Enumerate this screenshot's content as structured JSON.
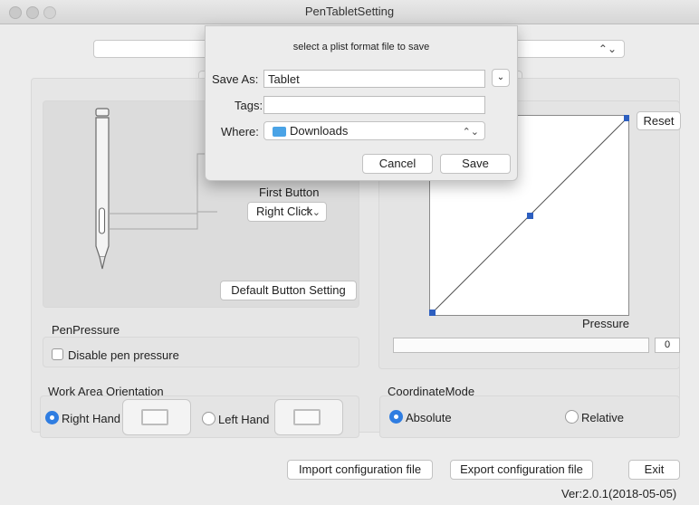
{
  "window": {
    "title": "PenTabletSetting"
  },
  "pen_buttons": {
    "first_button_label": "First Button",
    "first_button_value": "Right Click",
    "default_button_label": "Default  Button Setting"
  },
  "pen_pressure": {
    "section_label": "PenPressure",
    "disable_label": "Disable pen pressure"
  },
  "pressure_curve": {
    "reset_label": "Reset",
    "pressure_label": "Pressure",
    "pressure_value": "0"
  },
  "work_area": {
    "section_label": "Work Area Orientation",
    "right_hand_label": "Right Hand",
    "left_hand_label": "Left Hand",
    "selected": "right"
  },
  "coordinate_mode": {
    "section_label": "CoordinateMode",
    "absolute_label": "Absolute",
    "relative_label": "Relative",
    "selected": "absolute"
  },
  "footer": {
    "import_label": "Import configuration file",
    "export_label": "Export configuration file",
    "exit_label": "Exit",
    "version": "Ver:2.0.1(2018-05-05)"
  },
  "save_dialog": {
    "prompt": "select a plist format file to save",
    "save_as_label": "Save As:",
    "save_as_value": "Tablet",
    "tags_label": "Tags:",
    "tags_value": "",
    "where_label": "Where:",
    "where_value": "Downloads",
    "cancel_label": "Cancel",
    "save_label": "Save"
  },
  "colors": {
    "accent": "#2f7de1",
    "curve_point": "#2d5fc0",
    "folder": "#4aa3e6"
  }
}
